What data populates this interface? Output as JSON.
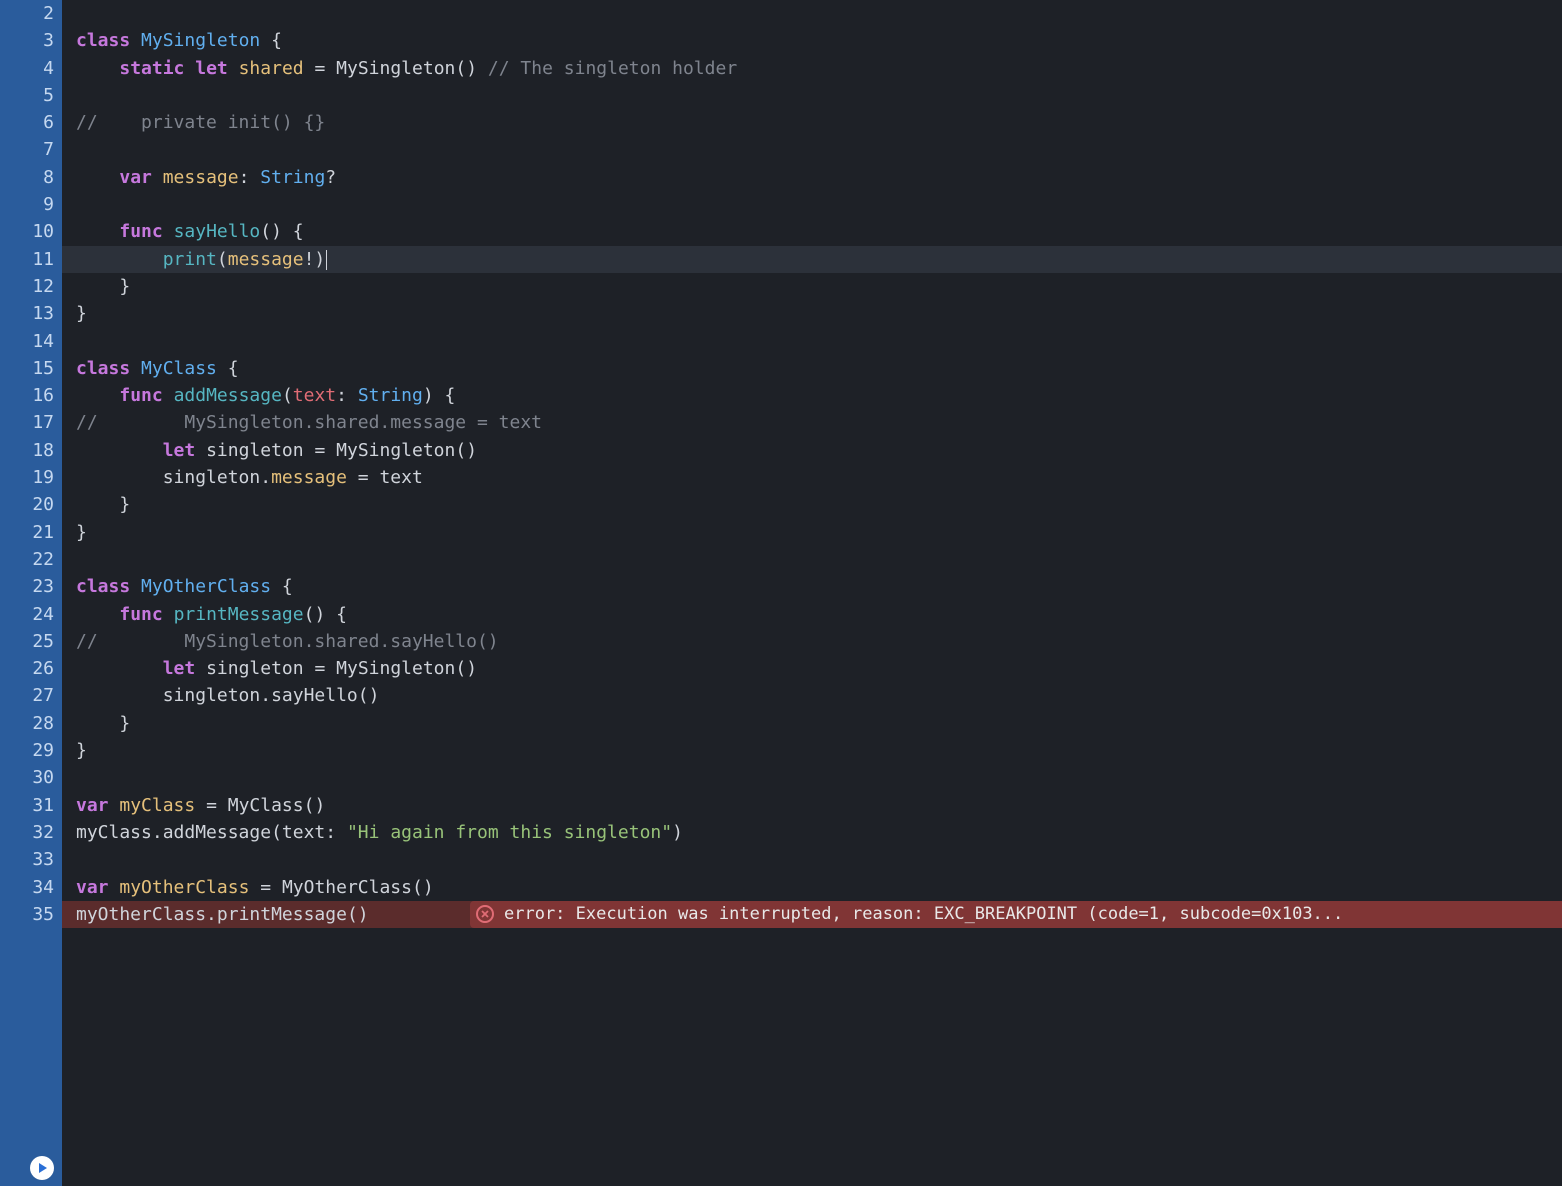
{
  "editor": {
    "startLine": 2,
    "highlightedLine": 11,
    "errorLine": 35,
    "lines": [
      {
        "n": 2,
        "tokens": []
      },
      {
        "n": 3,
        "tokens": [
          {
            "t": "kw",
            "v": "class"
          },
          {
            "t": "plain",
            "v": " "
          },
          {
            "t": "type",
            "v": "MySingleton"
          },
          {
            "t": "plain",
            "v": " "
          },
          {
            "t": "punct",
            "v": "{"
          }
        ]
      },
      {
        "n": 4,
        "tokens": [
          {
            "t": "plain",
            "v": "    "
          },
          {
            "t": "kw",
            "v": "static"
          },
          {
            "t": "plain",
            "v": " "
          },
          {
            "t": "kw",
            "v": "let"
          },
          {
            "t": "plain",
            "v": " "
          },
          {
            "t": "ident",
            "v": "shared"
          },
          {
            "t": "plain",
            "v": " "
          },
          {
            "t": "punct",
            "v": "="
          },
          {
            "t": "plain",
            "v": " "
          },
          {
            "t": "call",
            "v": "MySingleton"
          },
          {
            "t": "punct",
            "v": "()"
          },
          {
            "t": "plain",
            "v": " "
          },
          {
            "t": "comment",
            "v": "// The singleton holder"
          }
        ]
      },
      {
        "n": 5,
        "tokens": []
      },
      {
        "n": 6,
        "tokens": [
          {
            "t": "comment",
            "v": "//    private init() {}"
          }
        ]
      },
      {
        "n": 7,
        "tokens": []
      },
      {
        "n": 8,
        "tokens": [
          {
            "t": "plain",
            "v": "    "
          },
          {
            "t": "kw",
            "v": "var"
          },
          {
            "t": "plain",
            "v": " "
          },
          {
            "t": "ident",
            "v": "message"
          },
          {
            "t": "punct",
            "v": ":"
          },
          {
            "t": "plain",
            "v": " "
          },
          {
            "t": "type",
            "v": "String"
          },
          {
            "t": "punct",
            "v": "?"
          }
        ]
      },
      {
        "n": 9,
        "tokens": []
      },
      {
        "n": 10,
        "tokens": [
          {
            "t": "plain",
            "v": "    "
          },
          {
            "t": "kw",
            "v": "func"
          },
          {
            "t": "plain",
            "v": " "
          },
          {
            "t": "func",
            "v": "sayHello"
          },
          {
            "t": "punct",
            "v": "()"
          },
          {
            "t": "plain",
            "v": " "
          },
          {
            "t": "punct",
            "v": "{"
          }
        ]
      },
      {
        "n": 11,
        "tokens": [
          {
            "t": "plain",
            "v": "        "
          },
          {
            "t": "func",
            "v": "print"
          },
          {
            "t": "punct",
            "v": "("
          },
          {
            "t": "ident",
            "v": "message"
          },
          {
            "t": "punct",
            "v": "!)"
          }
        ],
        "cursor": true
      },
      {
        "n": 12,
        "tokens": [
          {
            "t": "plain",
            "v": "    "
          },
          {
            "t": "punct",
            "v": "}"
          }
        ]
      },
      {
        "n": 13,
        "tokens": [
          {
            "t": "punct",
            "v": "}"
          }
        ]
      },
      {
        "n": 14,
        "tokens": []
      },
      {
        "n": 15,
        "tokens": [
          {
            "t": "kw",
            "v": "class"
          },
          {
            "t": "plain",
            "v": " "
          },
          {
            "t": "type",
            "v": "MyClass"
          },
          {
            "t": "plain",
            "v": " "
          },
          {
            "t": "punct",
            "v": "{"
          }
        ]
      },
      {
        "n": 16,
        "tokens": [
          {
            "t": "plain",
            "v": "    "
          },
          {
            "t": "kw",
            "v": "func"
          },
          {
            "t": "plain",
            "v": " "
          },
          {
            "t": "func",
            "v": "addMessage"
          },
          {
            "t": "punct",
            "v": "("
          },
          {
            "t": "param",
            "v": "text"
          },
          {
            "t": "punct",
            "v": ":"
          },
          {
            "t": "plain",
            "v": " "
          },
          {
            "t": "type",
            "v": "String"
          },
          {
            "t": "punct",
            "v": ")"
          },
          {
            "t": "plain",
            "v": " "
          },
          {
            "t": "punct",
            "v": "{"
          }
        ]
      },
      {
        "n": 17,
        "tokens": [
          {
            "t": "comment",
            "v": "//        MySingleton.shared.message = text"
          }
        ]
      },
      {
        "n": 18,
        "tokens": [
          {
            "t": "plain",
            "v": "        "
          },
          {
            "t": "kw",
            "v": "let"
          },
          {
            "t": "plain",
            "v": " "
          },
          {
            "t": "plain",
            "v": "singleton"
          },
          {
            "t": "plain",
            "v": " "
          },
          {
            "t": "punct",
            "v": "="
          },
          {
            "t": "plain",
            "v": " "
          },
          {
            "t": "call",
            "v": "MySingleton"
          },
          {
            "t": "punct",
            "v": "()"
          }
        ]
      },
      {
        "n": 19,
        "tokens": [
          {
            "t": "plain",
            "v": "        singleton"
          },
          {
            "t": "punct",
            "v": "."
          },
          {
            "t": "ident",
            "v": "message"
          },
          {
            "t": "plain",
            "v": " "
          },
          {
            "t": "punct",
            "v": "="
          },
          {
            "t": "plain",
            "v": " text"
          }
        ]
      },
      {
        "n": 20,
        "tokens": [
          {
            "t": "plain",
            "v": "    "
          },
          {
            "t": "punct",
            "v": "}"
          }
        ]
      },
      {
        "n": 21,
        "tokens": [
          {
            "t": "punct",
            "v": "}"
          }
        ]
      },
      {
        "n": 22,
        "tokens": []
      },
      {
        "n": 23,
        "tokens": [
          {
            "t": "kw",
            "v": "class"
          },
          {
            "t": "plain",
            "v": " "
          },
          {
            "t": "type",
            "v": "MyOtherClass"
          },
          {
            "t": "plain",
            "v": " "
          },
          {
            "t": "punct",
            "v": "{"
          }
        ]
      },
      {
        "n": 24,
        "tokens": [
          {
            "t": "plain",
            "v": "    "
          },
          {
            "t": "kw",
            "v": "func"
          },
          {
            "t": "plain",
            "v": " "
          },
          {
            "t": "func",
            "v": "printMessage"
          },
          {
            "t": "punct",
            "v": "()"
          },
          {
            "t": "plain",
            "v": " "
          },
          {
            "t": "punct",
            "v": "{"
          }
        ]
      },
      {
        "n": 25,
        "tokens": [
          {
            "t": "comment",
            "v": "//        MySingleton.shared.sayHello()"
          }
        ]
      },
      {
        "n": 26,
        "tokens": [
          {
            "t": "plain",
            "v": "        "
          },
          {
            "t": "kw",
            "v": "let"
          },
          {
            "t": "plain",
            "v": " "
          },
          {
            "t": "plain",
            "v": "singleton"
          },
          {
            "t": "plain",
            "v": " "
          },
          {
            "t": "punct",
            "v": "="
          },
          {
            "t": "plain",
            "v": " "
          },
          {
            "t": "call",
            "v": "MySingleton"
          },
          {
            "t": "punct",
            "v": "()"
          }
        ]
      },
      {
        "n": 27,
        "tokens": [
          {
            "t": "plain",
            "v": "        singleton"
          },
          {
            "t": "punct",
            "v": "."
          },
          {
            "t": "call",
            "v": "sayHello"
          },
          {
            "t": "punct",
            "v": "()"
          }
        ]
      },
      {
        "n": 28,
        "tokens": [
          {
            "t": "plain",
            "v": "    "
          },
          {
            "t": "punct",
            "v": "}"
          }
        ]
      },
      {
        "n": 29,
        "tokens": [
          {
            "t": "punct",
            "v": "}"
          }
        ]
      },
      {
        "n": 30,
        "tokens": []
      },
      {
        "n": 31,
        "tokens": [
          {
            "t": "kw",
            "v": "var"
          },
          {
            "t": "plain",
            "v": " "
          },
          {
            "t": "ident",
            "v": "myClass"
          },
          {
            "t": "plain",
            "v": " "
          },
          {
            "t": "punct",
            "v": "="
          },
          {
            "t": "plain",
            "v": " "
          },
          {
            "t": "call",
            "v": "MyClass"
          },
          {
            "t": "punct",
            "v": "()"
          }
        ]
      },
      {
        "n": 32,
        "tokens": [
          {
            "t": "plain",
            "v": "myClass"
          },
          {
            "t": "punct",
            "v": "."
          },
          {
            "t": "call",
            "v": "addMessage"
          },
          {
            "t": "punct",
            "v": "("
          },
          {
            "t": "plain",
            "v": "text"
          },
          {
            "t": "punct",
            "v": ":"
          },
          {
            "t": "plain",
            "v": " "
          },
          {
            "t": "str",
            "v": "\"Hi again from this singleton\""
          },
          {
            "t": "punct",
            "v": ")"
          }
        ]
      },
      {
        "n": 33,
        "tokens": []
      },
      {
        "n": 34,
        "tokens": [
          {
            "t": "kw",
            "v": "var"
          },
          {
            "t": "plain",
            "v": " "
          },
          {
            "t": "ident",
            "v": "myOtherClass"
          },
          {
            "t": "plain",
            "v": " "
          },
          {
            "t": "punct",
            "v": "="
          },
          {
            "t": "plain",
            "v": " "
          },
          {
            "t": "call",
            "v": "MyOtherClass"
          },
          {
            "t": "punct",
            "v": "()"
          }
        ]
      },
      {
        "n": 35,
        "tokens": [
          {
            "t": "plain",
            "v": "myOtherClass"
          },
          {
            "t": "punct",
            "v": "."
          },
          {
            "t": "call",
            "v": "printMessage"
          },
          {
            "t": "punct",
            "v": "()"
          }
        ]
      }
    ]
  },
  "error": {
    "message": "error: Execution was interrupted, reason: EXC_BREAKPOINT (code=1, subcode=0x103..."
  }
}
